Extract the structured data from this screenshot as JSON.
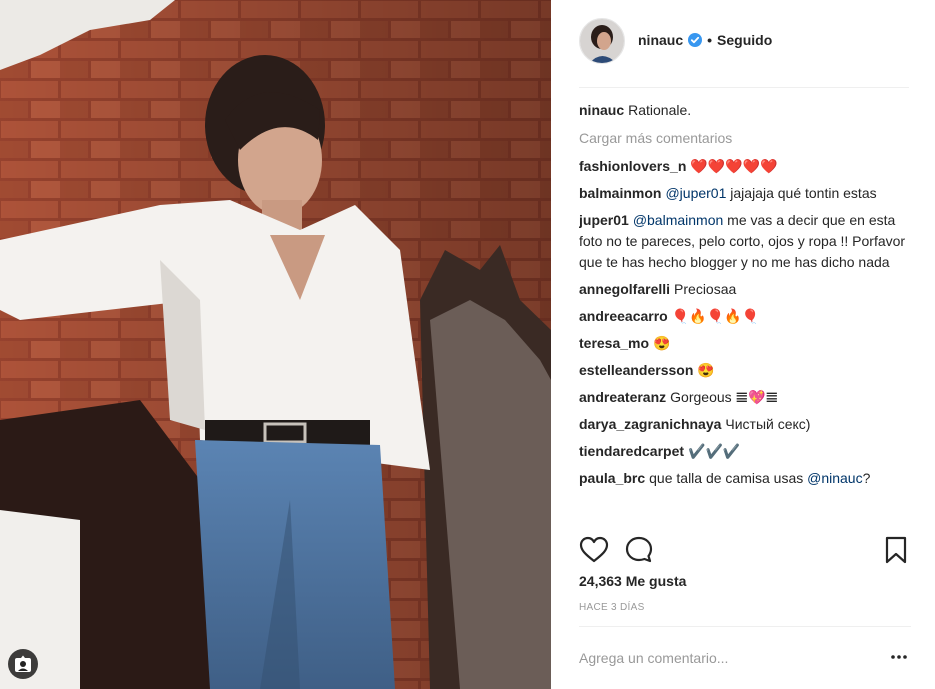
{
  "post": {
    "username": "ninauc",
    "follow_status": "Seguido",
    "caption_user": "ninauc",
    "caption_text": "Rationale.",
    "load_more": "Cargar más comentarios",
    "likes": "24,363 Me gusta",
    "timestamp": "HACE 3 DÍAS",
    "add_comment_placeholder": "Agrega un comentario...",
    "accent_color": "#3897f0",
    "mention_color": "#003569"
  },
  "comments": [
    {
      "user": "fashionlovers_n",
      "text": "❤️❤️❤️❤️❤️"
    },
    {
      "user": "balmainmon",
      "mention": "@juper01",
      "text": " jajajaja qué tontin estas"
    },
    {
      "user": "juper01",
      "mention": "@balmainmon",
      "text": " me vas a decir que en esta foto no te pareces, pelo corto, ojos y ropa !! Porfavor que te has hecho blogger y no me has dicho nada"
    },
    {
      "user": "annegolfarelli",
      "text": "Preciosaa"
    },
    {
      "user": "andreeacarro",
      "text": "🎈🔥🎈🔥🎈"
    },
    {
      "user": "teresa_mo",
      "text": "😍"
    },
    {
      "user": "estelleandersson",
      "text": "😍"
    },
    {
      "user": "andreateranz",
      "text": "Gorgeous 𝌆💖𝌆"
    },
    {
      "user": "darya_zagranichnaya",
      "text": "Чистый секс)"
    },
    {
      "user": "tiendaredcarpet",
      "text": "✔️✔️✔️"
    },
    {
      "user": "paula_brc",
      "text": "que talla de camisa usas ",
      "mention": "@ninauc",
      "text_after": "?"
    }
  ],
  "icons": {
    "like": "heart-icon",
    "comment": "comment-bubble-icon",
    "save": "bookmark-icon",
    "more": "more-dots-icon",
    "verified": "verified-badge-icon",
    "tag": "user-tag-icon"
  }
}
